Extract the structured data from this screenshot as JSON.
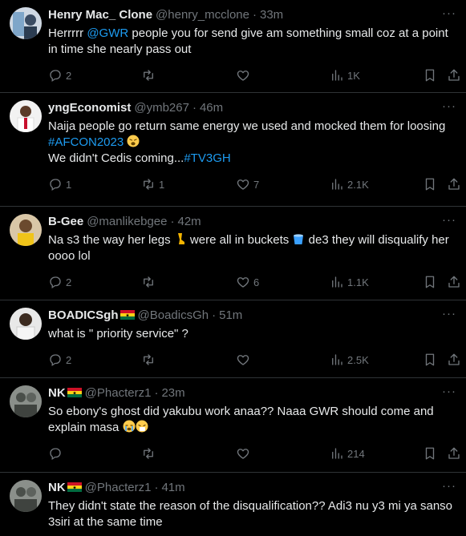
{
  "tweets": [
    {
      "name": "Henry Mac_ Clone",
      "handle": "@henry_mcclone",
      "time": "33m",
      "text_parts": [
        "Herrrrr ",
        "@GWR",
        " people you for send give am something small coz at a point in time she nearly pass out"
      ],
      "reply_count": "2",
      "retweet_count": "",
      "like_count": "",
      "view_count": "1K"
    },
    {
      "name": "yngEconomist",
      "handle": "@ymb267",
      "time": "46m",
      "text_parts": [
        "Naija people go return same energy we used and mocked them for loosing ",
        "#AFCON2023",
        "We didn't Cedis coming...",
        "#TV3GH"
      ],
      "reply_count": "1",
      "retweet_count": "1",
      "like_count": "7",
      "view_count": "2.1K"
    },
    {
      "name": "B-Gee",
      "handle": "@manlikebgee",
      "time": "42m",
      "text_parts": [
        "Na s3 the way her legs ",
        " were all in buckets ",
        " de3 they will disqualify her oooo lol"
      ],
      "reply_count": "2",
      "retweet_count": "",
      "like_count": "6",
      "view_count": "1.1K"
    },
    {
      "name": "BOADICSgh",
      "handle": "@BoadicsGh",
      "time": "51m",
      "text_parts": [
        "what is \" priority service\" ?"
      ],
      "reply_count": "2",
      "retweet_count": "",
      "like_count": "",
      "view_count": "2.5K"
    },
    {
      "name": "NK",
      "handle": "@Phacterz1",
      "time": "23m",
      "text_parts": [
        "So ebony's ghost did yakubu work anaa?? Naaa GWR should come and explain masa "
      ],
      "reply_count": "",
      "retweet_count": "",
      "like_count": "",
      "view_count": "214"
    },
    {
      "name": "NK",
      "handle": "@Phacterz1",
      "time": "41m",
      "text_parts": [
        "They didn't state the reason of the disqualification?? Adi3 nu y3 mi ya sanso 3siri at the same time"
      ]
    }
  ],
  "separator": "·",
  "more_label": "···",
  "icons": {
    "reply": "reply-icon",
    "retweet": "retweet-icon",
    "like": "like-icon",
    "views": "views-icon",
    "bookmark": "bookmark-icon",
    "share": "share-icon",
    "ghana_flag": "ghana-flag-icon"
  },
  "colors": {
    "background": "#000000",
    "text": "#e7e9ea",
    "muted": "#71767b",
    "link": "#1d9bf0",
    "divider": "#2f3336"
  }
}
